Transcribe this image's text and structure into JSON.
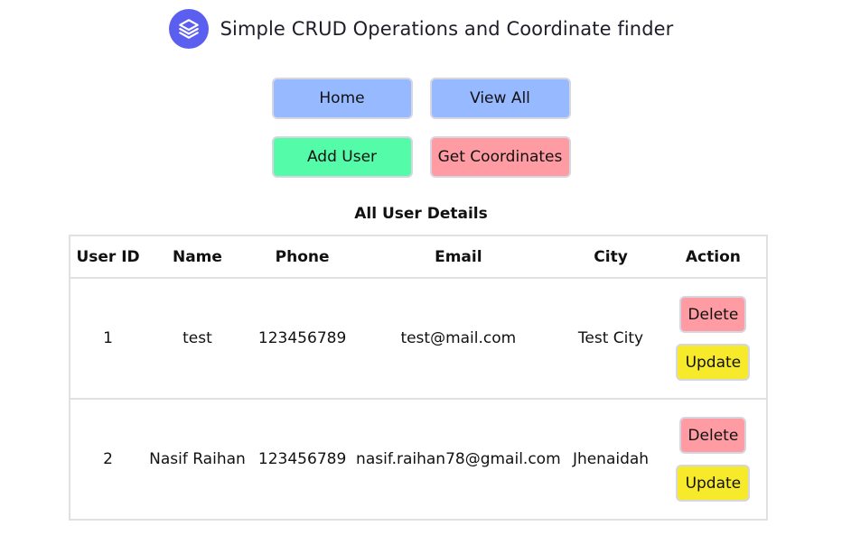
{
  "header": {
    "title": "Simple CRUD Operations and Coordinate finder",
    "logo_icon": "layers-icon",
    "logo_color": "#5b5ff0"
  },
  "nav": {
    "home_label": "Home",
    "view_all_label": "View All",
    "add_user_label": "Add User",
    "get_coordinates_label": "Get Coordinates"
  },
  "colors": {
    "blue_button": "#96b9ff",
    "green_button": "#54fca9",
    "pink_button": "#ff9ca3",
    "yellow_button": "#f7ea2a"
  },
  "table": {
    "title": "All User Details",
    "headers": [
      "User ID",
      "Name",
      "Phone",
      "Email",
      "City",
      "Action"
    ],
    "rows": [
      {
        "id": "1",
        "name": "test",
        "phone": "123456789",
        "email": "test@mail.com",
        "city": "Test City",
        "delete_label": "Delete",
        "update_label": "Update"
      },
      {
        "id": "2",
        "name": "Nasif Raihan",
        "phone": "123456789",
        "email": "nasif.raihan78@gmail.com",
        "city": "Jhenaidah",
        "delete_label": "Delete",
        "update_label": "Update"
      }
    ]
  }
}
